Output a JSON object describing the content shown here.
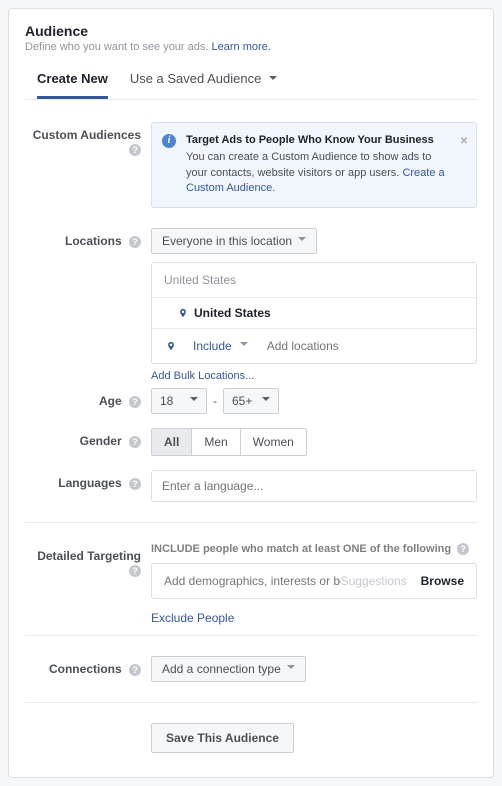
{
  "header": {
    "title": "Audience",
    "subtitle_text": "Define who you want to see your ads. ",
    "learn_more": "Learn more."
  },
  "tabs": {
    "create_new": "Create New",
    "use_saved": "Use a Saved Audience"
  },
  "labels": {
    "custom_audiences": "Custom Audiences",
    "locations": "Locations",
    "age": "Age",
    "gender": "Gender",
    "languages": "Languages",
    "detailed_targeting": "Detailed Targeting",
    "connections": "Connections"
  },
  "custom_audience_info": {
    "title": "Target Ads to People Who Know Your Business",
    "body": "You can create a Custom Audience to show ads to your contacts, website visitors or app users. ",
    "link": "Create a Custom Audience."
  },
  "locations": {
    "scope_button": "Everyone in this location",
    "region_label": "United States",
    "selected_value": "United States",
    "include_label": "Include",
    "add_placeholder": "Add locations",
    "bulk_link": "Add Bulk Locations..."
  },
  "age": {
    "min": "18",
    "max": "65+"
  },
  "gender": {
    "all": "All",
    "men": "Men",
    "women": "Women"
  },
  "languages": {
    "placeholder": "Enter a language..."
  },
  "detailed_targeting": {
    "include_label": "INCLUDE people who match at least ONE of the following",
    "placeholder": "Add demographics, interests or behaviors",
    "suggestions": "Suggestions",
    "browse": "Browse",
    "exclude_link": "Exclude People"
  },
  "connections": {
    "button": "Add a connection type"
  },
  "save_button": "Save This Audience"
}
